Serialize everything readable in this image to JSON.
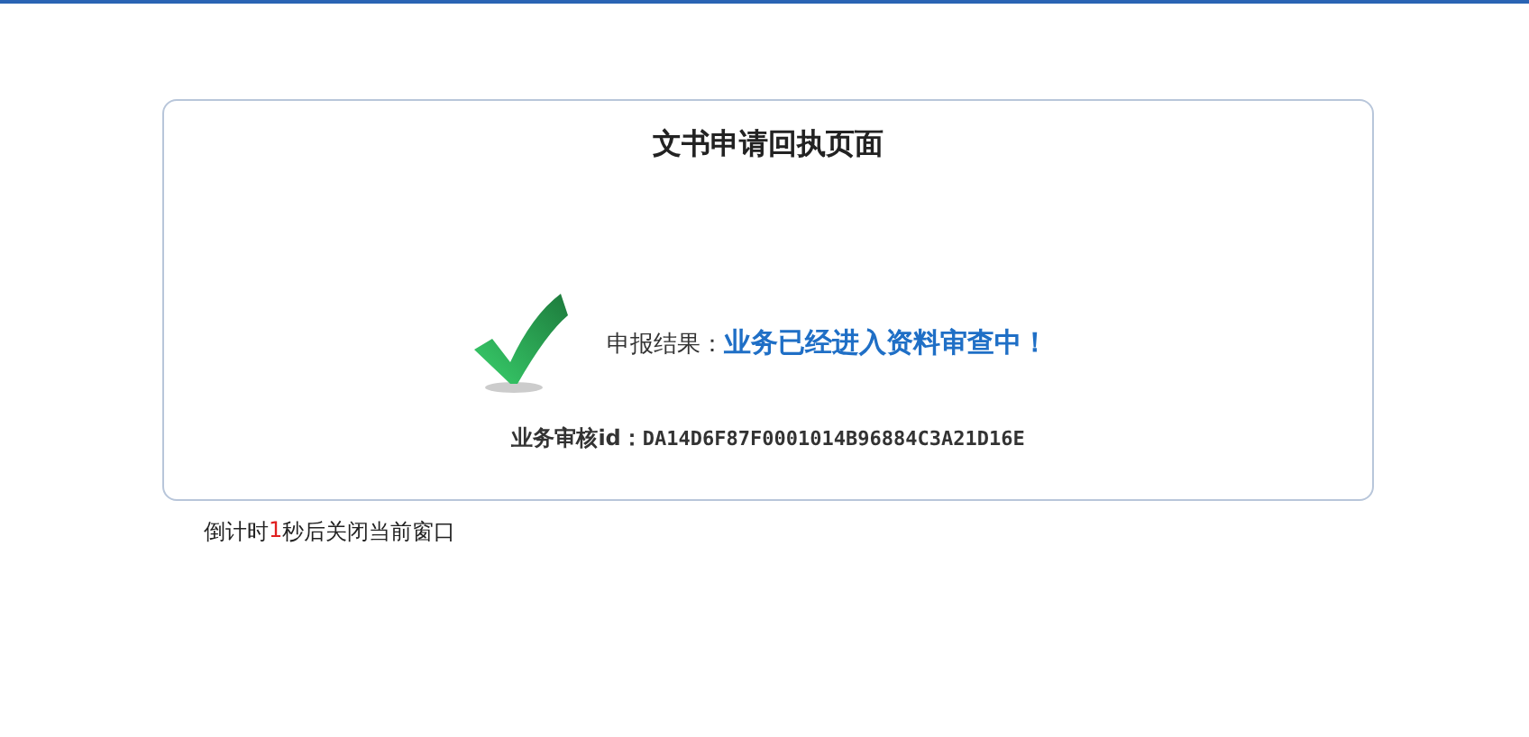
{
  "title": "文书申请回执页面",
  "result": {
    "label": "申报结果：",
    "message": "业务已经进入资料审查中！"
  },
  "review_id": {
    "label": "业务审核id：",
    "value": "DA14D6F87F0001014B96884C3A21D16E"
  },
  "countdown": {
    "prefix": "倒计时",
    "seconds": "1",
    "suffix": "秒后关闭当前窗口"
  }
}
